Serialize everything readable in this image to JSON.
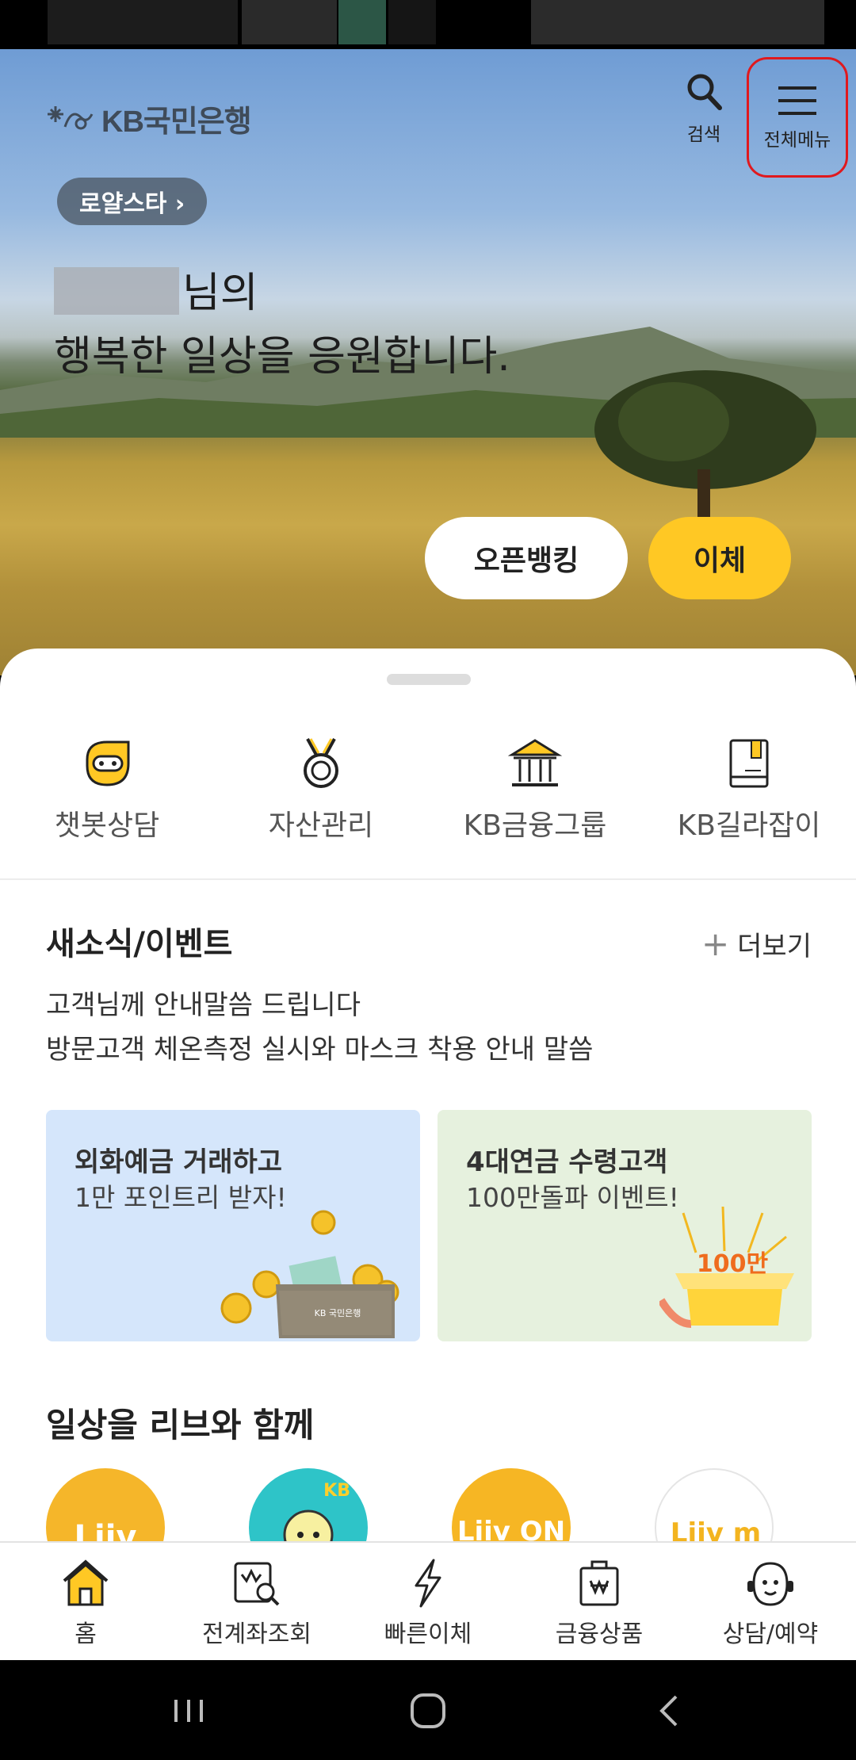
{
  "header": {
    "brand": "KB국민은행",
    "search_label": "검색",
    "menu_label": "전체메뉴"
  },
  "hero": {
    "grade_badge": "로얄스타 ›",
    "greeting_line1": "님의",
    "greeting_line2": "행복한 일상을 응원합니다.",
    "open_banking_label": "오픈뱅킹",
    "transfer_label": "이체"
  },
  "quick_menu": [
    {
      "label": "챗봇상담",
      "icon": "chatbot-icon"
    },
    {
      "label": "자산관리",
      "icon": "medal-icon"
    },
    {
      "label": "KB금융그룹",
      "icon": "bank-building-icon"
    },
    {
      "label": "KB길라잡이",
      "icon": "guide-book-icon"
    }
  ],
  "news": {
    "title": "새소식/이벤트",
    "more_label": "더보기",
    "lines": [
      "고객님께 안내말씀 드립니다",
      "방문고객 체온측정 실시와 마스크 착용 안내 말씀"
    ]
  },
  "banners": [
    {
      "headline": "외화예금 거래하고",
      "sub": "1만 포인트리 받자!",
      "wallet_brand": "KB 국민은행"
    },
    {
      "headline": "4대연금 수령고객",
      "sub": "100만돌파 이벤트!",
      "box_text": "100만"
    }
  ],
  "daily": {
    "title": "일상을 리브와 함께",
    "apps": [
      "Liiv",
      "KB",
      "Liiv ON",
      "Liiv m"
    ]
  },
  "bottom_nav": [
    {
      "label": "홈",
      "icon": "home-icon"
    },
    {
      "label": "전계좌조회",
      "icon": "account-search-icon"
    },
    {
      "label": "빠른이체",
      "icon": "lightning-icon"
    },
    {
      "label": "금융상품",
      "icon": "product-bag-icon"
    },
    {
      "label": "상담/예약",
      "icon": "consultant-icon"
    }
  ],
  "colors": {
    "accent_yellow": "#ffc824",
    "highlight_red": "#e0191e",
    "brand_gray": "#3f4b59"
  }
}
